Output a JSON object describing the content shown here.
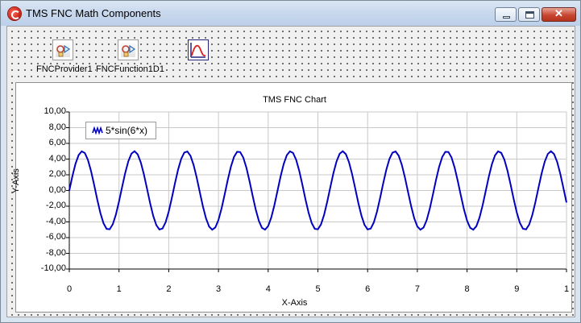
{
  "window": {
    "title": "TMS FNC Math Components",
    "close_glyph": "✕"
  },
  "components": [
    {
      "label": "FNCProvider1",
      "icon": "fnc-provider-icon"
    },
    {
      "label": "FNCFunction1D1",
      "icon": "fnc-function-icon"
    },
    {
      "label": "",
      "icon": "fnc-chart-icon"
    }
  ],
  "chart_data": {
    "type": "line",
    "title": "TMS FNC Chart",
    "xlabel": "X-Axis",
    "ylabel": "Y-Axis",
    "xlim": [
      0,
      10
    ],
    "ylim": [
      -10,
      10
    ],
    "x_ticks": [
      "0",
      "1",
      "2",
      "3",
      "4",
      "5",
      "6",
      "7",
      "8",
      "9",
      "1"
    ],
    "y_ticks": [
      "10,00",
      "8,00",
      "6,00",
      "4,00",
      "2,00",
      "0,00",
      "-2,00",
      "-4,00",
      "-6,00",
      "-8,00",
      "-10,00"
    ],
    "grid": true,
    "legend_position": "top-left",
    "series": [
      {
        "name": "5*sin(6*x)",
        "function": "5*sin(6*x)",
        "color": "#0000c0",
        "x_range": [
          0,
          10
        ]
      }
    ]
  },
  "colors": {
    "series": "#0000c0",
    "grid": "#c8c8c8"
  }
}
